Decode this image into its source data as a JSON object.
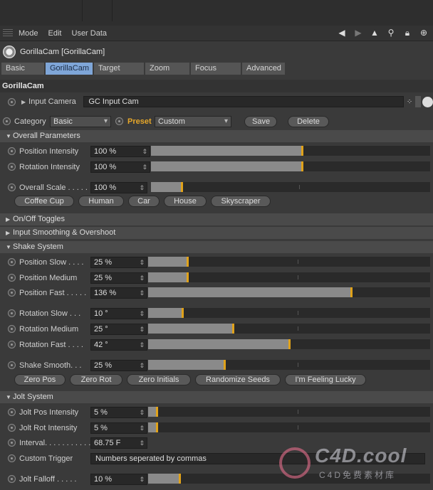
{
  "menu": {
    "items": [
      "Mode",
      "Edit",
      "User Data"
    ]
  },
  "object": {
    "title": "GorillaCam [GorillaCam]"
  },
  "tabs": [
    "Basic",
    "GorillaCam",
    "Target",
    "Zoom",
    "Focus",
    "Advanced"
  ],
  "section": {
    "title": "GorillaCam"
  },
  "input_camera": {
    "label": "Input Camera",
    "value": "GC Input Cam"
  },
  "category": {
    "label": "Category",
    "value": "Basic",
    "preset_label": "Preset",
    "preset_value": "Custom",
    "save": "Save",
    "delete": "Delete"
  },
  "groups": {
    "overall": "Overall Parameters",
    "onoff": "On/Off Toggles",
    "smoothing": "Input Smoothing & Overshoot",
    "shake": "Shake System",
    "jolt": "Jolt System"
  },
  "overall": [
    {
      "label": "Position Intensity",
      "value": "100 %",
      "fraction": 0.54
    },
    {
      "label": "Rotation Intensity",
      "value": "100 %",
      "fraction": 0.54
    }
  ],
  "overall_scale": {
    "label": "Overall Scale . . . . .",
    "value": "100 %",
    "fraction": 0.11
  },
  "scale_presets": [
    "Coffee Cup",
    "Human",
    "Car",
    "House",
    "Skyscraper"
  ],
  "shake_rows": [
    {
      "label": "Position Slow . . . .",
      "value": "25 %",
      "fraction": 0.14
    },
    {
      "label": "Position Medium",
      "value": "25 %",
      "fraction": 0.14
    },
    {
      "label": "Position Fast . . . . .",
      "value": "136 %",
      "fraction": 0.72
    }
  ],
  "shake_rot_rows": [
    {
      "label": "Rotation Slow . . .",
      "value": "10 °",
      "fraction": 0.12
    },
    {
      "label": "Rotation Medium",
      "value": "25 °",
      "fraction": 0.3
    },
    {
      "label": "Rotation Fast . . . .",
      "value": "42 °",
      "fraction": 0.5
    }
  ],
  "shake_smooth": {
    "label": "Shake Smooth. . .",
    "value": "25 %",
    "fraction": 0.27
  },
  "shake_buttons": [
    "Zero Pos",
    "Zero Rot",
    "Zero Initials",
    "Randomize Seeds",
    "I'm Feeling Lucky"
  ],
  "jolt_rows": [
    {
      "label": "Jolt Pos Intensity",
      "value": "5 %",
      "fraction": 0.03
    },
    {
      "label": "Jolt Rot Intensity",
      "value": "5 %",
      "fraction": 0.03
    }
  ],
  "interval": {
    "label": "Interval. . . . . . . . . . .",
    "value": "68.75 F"
  },
  "custom_trigger": {
    "label": "Custom Trigger",
    "value": "Numbers seperated by commas"
  },
  "jolt_falloff": {
    "label": "Jolt Falloff . . . . .",
    "value": "10 %",
    "fraction": 0.11
  },
  "watermark": {
    "big": "C4D.cool",
    "small": "C4D免费素材库"
  }
}
